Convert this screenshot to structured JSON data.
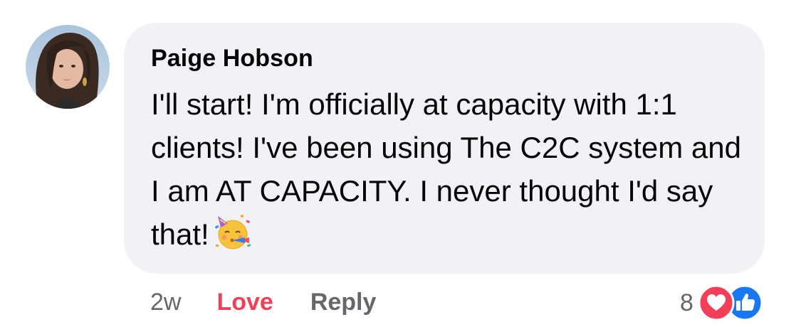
{
  "comment": {
    "author": "Paige Hobson",
    "text": "I'll start! I'm officially at capacity with 1:1 clients! I've been using The C2C system and I am AT CAPACITY. I never thought I'd say that!",
    "emoji_icon": "partying-face-icon"
  },
  "actions": {
    "timestamp": "2w",
    "love_label": "Love",
    "reply_label": "Reply"
  },
  "reactions": {
    "count": "8",
    "icons": [
      "love-reaction-icon",
      "like-reaction-icon"
    ]
  },
  "colors": {
    "bubble_bg": "#f0f2f5",
    "love": "#f33e58",
    "like": "#1877f2",
    "meta_text": "#65676b"
  }
}
